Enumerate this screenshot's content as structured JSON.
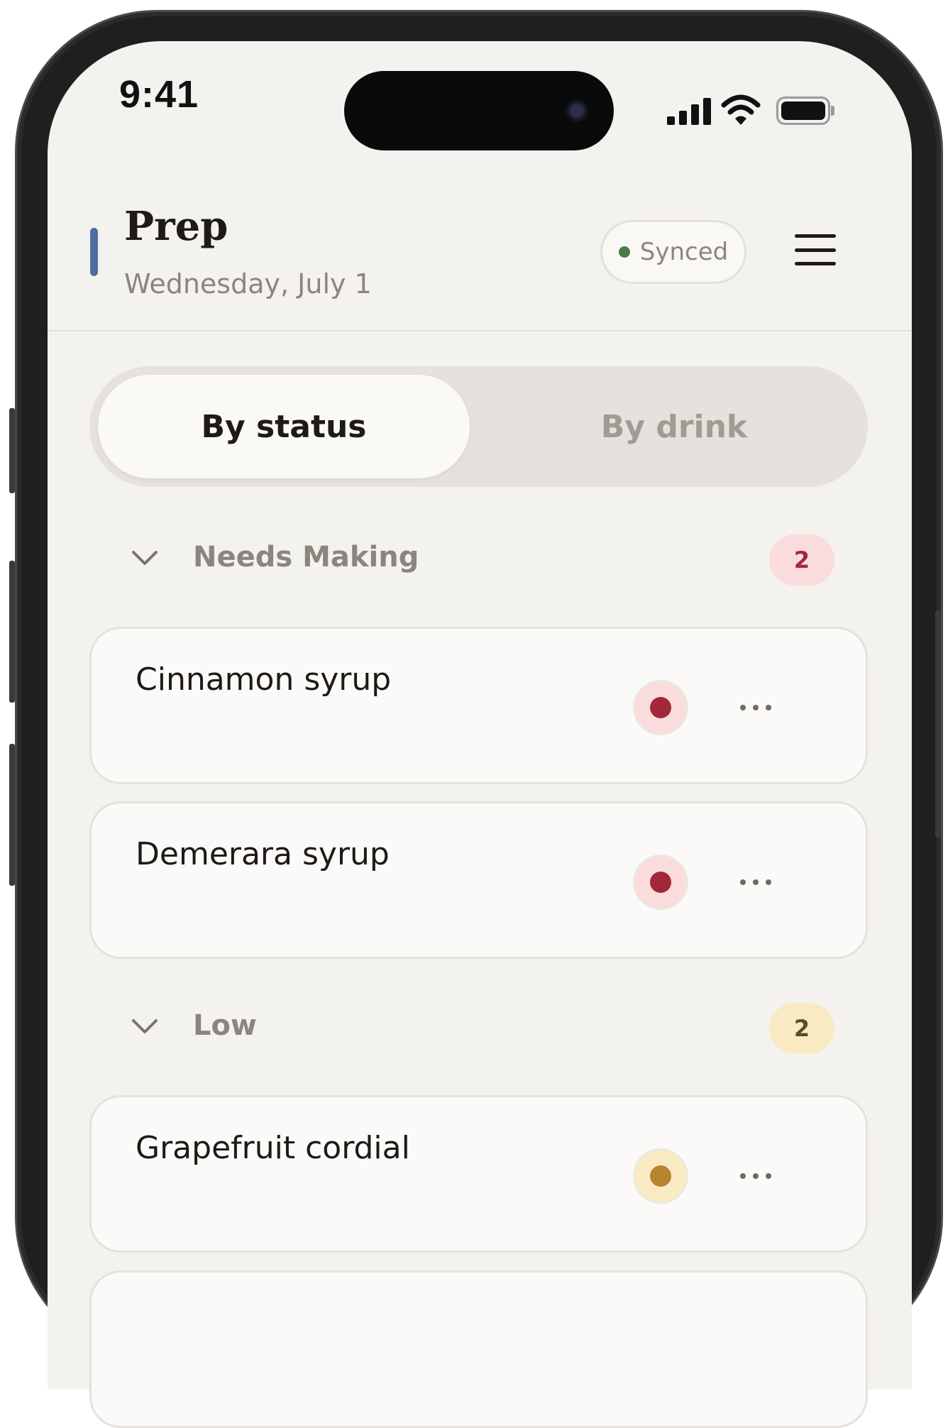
{
  "status_bar": {
    "time": "9:41",
    "icons": [
      "cellular-signal-icon",
      "wifi-icon",
      "battery-icon"
    ]
  },
  "header": {
    "title": "Prep",
    "subtitle": "Wednesday, July 1",
    "sync_status": "Synced",
    "menu_icon": "hamburger-menu-icon"
  },
  "segmented_control": {
    "options": [
      {
        "label": "By status",
        "selected": true
      },
      {
        "label": "By drink",
        "selected": false
      }
    ]
  },
  "sections": [
    {
      "title": "Needs Making",
      "count": "2",
      "expanded": true,
      "items": [
        {
          "name": "Cinnamon syrup"
        },
        {
          "name": "Demerara syrup"
        }
      ]
    },
    {
      "title": "Low",
      "count": "2",
      "expanded": true,
      "items": [
        {
          "name": "Grapefruit cordial"
        }
      ]
    }
  ],
  "colors": {
    "background": "#f4f2ee",
    "card": "#fbfaf8",
    "accent_blue": "#4f6fa0",
    "sync_green": "#4c7a48",
    "needs_making_dot": "#a3273a",
    "needs_making_bg": "#fadcdc",
    "low_dot": "#b8832e",
    "low_bg": "#faeac4",
    "text_primary": "#1d1a17",
    "text_secondary": "#8b857e"
  }
}
